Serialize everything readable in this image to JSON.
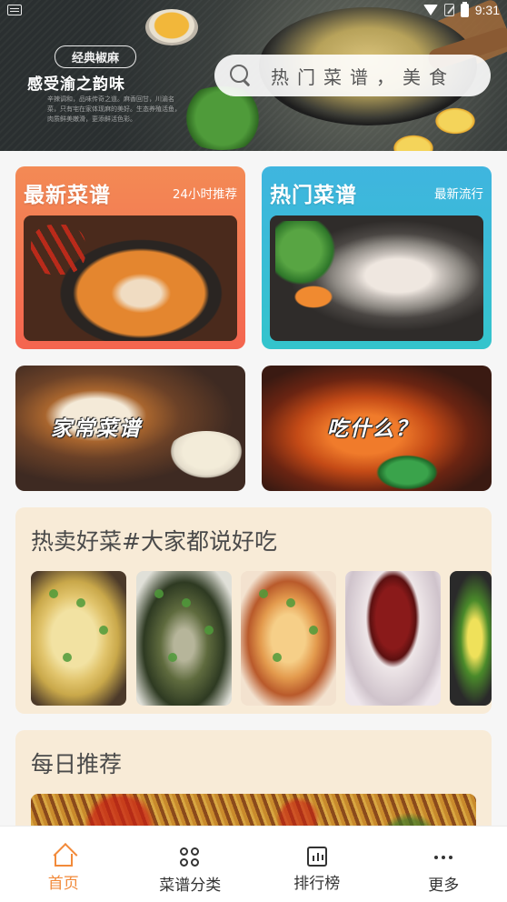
{
  "status_bar": {
    "time": "9:31"
  },
  "banner": {
    "tag": "经典椒麻",
    "title": "感受渝之韵味",
    "fine_print": "辛辣调和，品味传奇之道。麻香回甘，川渝名菜，只有宅在家体现麻的美好。生态养殖活鱼，肉质鲜美嫩滑，更添鲜活色彩。"
  },
  "search": {
    "placeholder": "热门菜谱，美食"
  },
  "cards": {
    "latest": {
      "title": "最新菜谱",
      "subtitle": "24小时推荐",
      "color": "#f4654f"
    },
    "hot": {
      "title": "热门菜谱",
      "subtitle": "最新流行",
      "color": "#3fb5df"
    },
    "home": {
      "title": "家常菜谱"
    },
    "eat": {
      "title": "吃什么？"
    }
  },
  "sections": {
    "hot_selling": {
      "title": "热卖好菜#大家都说好吃"
    },
    "daily": {
      "title": "每日推荐"
    }
  },
  "bottom_nav": {
    "items": [
      {
        "label": "首页",
        "icon": "home-icon",
        "active": true
      },
      {
        "label": "菜谱分类",
        "icon": "category-icon",
        "active": false
      },
      {
        "label": "排行榜",
        "icon": "ranking-icon",
        "active": false
      },
      {
        "label": "更多",
        "icon": "more-icon",
        "active": false
      }
    ],
    "active_color": "#f28a3a"
  }
}
